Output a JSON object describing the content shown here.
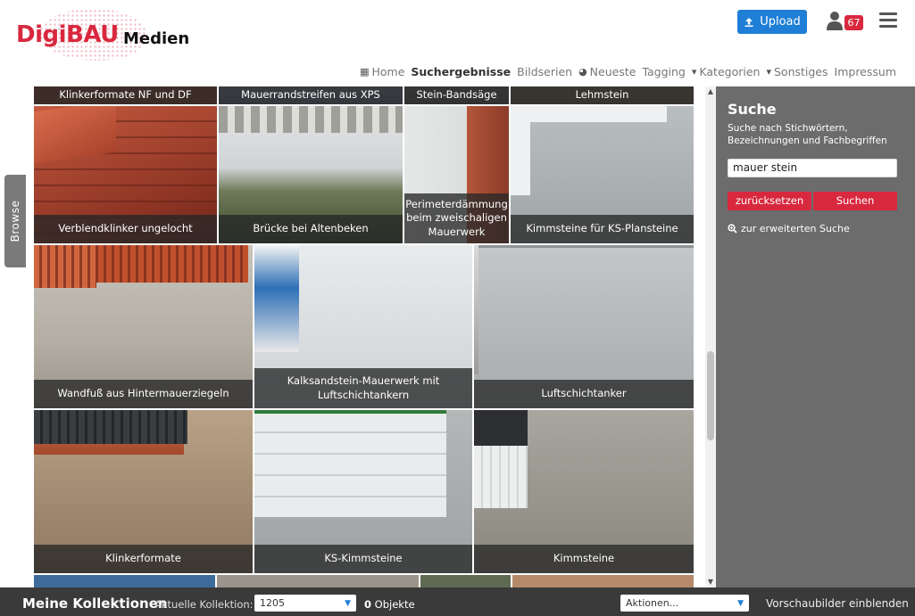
{
  "header": {
    "logo_brand": "DigiBAU",
    "logo_sub": "Medien",
    "upload_label": "Upload",
    "notification_count": "67"
  },
  "nav": {
    "items": [
      {
        "label": "Home",
        "icon": "grid-icon"
      },
      {
        "label": "Suchergebnisse",
        "active": true
      },
      {
        "label": "Bildserien"
      },
      {
        "label": "Neueste",
        "icon": "clock-icon"
      },
      {
        "label": "Tagging"
      },
      {
        "label": "Kategorien",
        "icon": "caret-down-icon"
      },
      {
        "label": "Sonstiges",
        "icon": "caret-down-icon"
      },
      {
        "label": "Impressum"
      }
    ]
  },
  "sidebar": {
    "browse_label": "Browse"
  },
  "gallery": {
    "tiles": [
      {
        "caption": "Klinkerformate NF und DF"
      },
      {
        "caption": "Mauerrandstreifen aus XPS"
      },
      {
        "caption": "Stein-Bandsäge"
      },
      {
        "caption": "Lehmstein"
      },
      {
        "caption": "Verblendklinker ungelocht"
      },
      {
        "caption": "Brücke bei Altenbeken"
      },
      {
        "caption": "Perimeterdämmung beim zweischaligen Mauerwerk"
      },
      {
        "caption": "Kimmsteine für KS-Plansteine"
      },
      {
        "caption": "Wandfuß aus Hintermauerziegeln"
      },
      {
        "caption": "Kalksandstein-Mauerwerk mit Luftschichtankern"
      },
      {
        "caption": "Luftschichtanker"
      },
      {
        "caption": "Klinkerformate"
      },
      {
        "caption": "KS-Kimmsteine"
      },
      {
        "caption": "Kimmsteine"
      }
    ]
  },
  "search": {
    "title": "Suche",
    "description": "Suche nach Stichwörtern, Bezeichnungen und Fachbegriffen",
    "value": "mauer stein",
    "reset_label": "zurücksetzen",
    "submit_label": "Suchen",
    "advanced_label": "zur erweiterten Suche"
  },
  "collections": {
    "title": "Meine Kollektionen",
    "current_label": "Aktuelle Kollektion:",
    "current_value": "1205",
    "count": "0",
    "count_unit": "Objekte",
    "actions_label": "Aktionen...",
    "thumbs_toggle": "Vorschaubilder einblenden"
  },
  "colors": {
    "brand_red": "#d8283e",
    "upload_blue": "#1f7fd6",
    "panel_gray": "#6c6c6c",
    "bottom_bar": "#3a3a3a"
  }
}
